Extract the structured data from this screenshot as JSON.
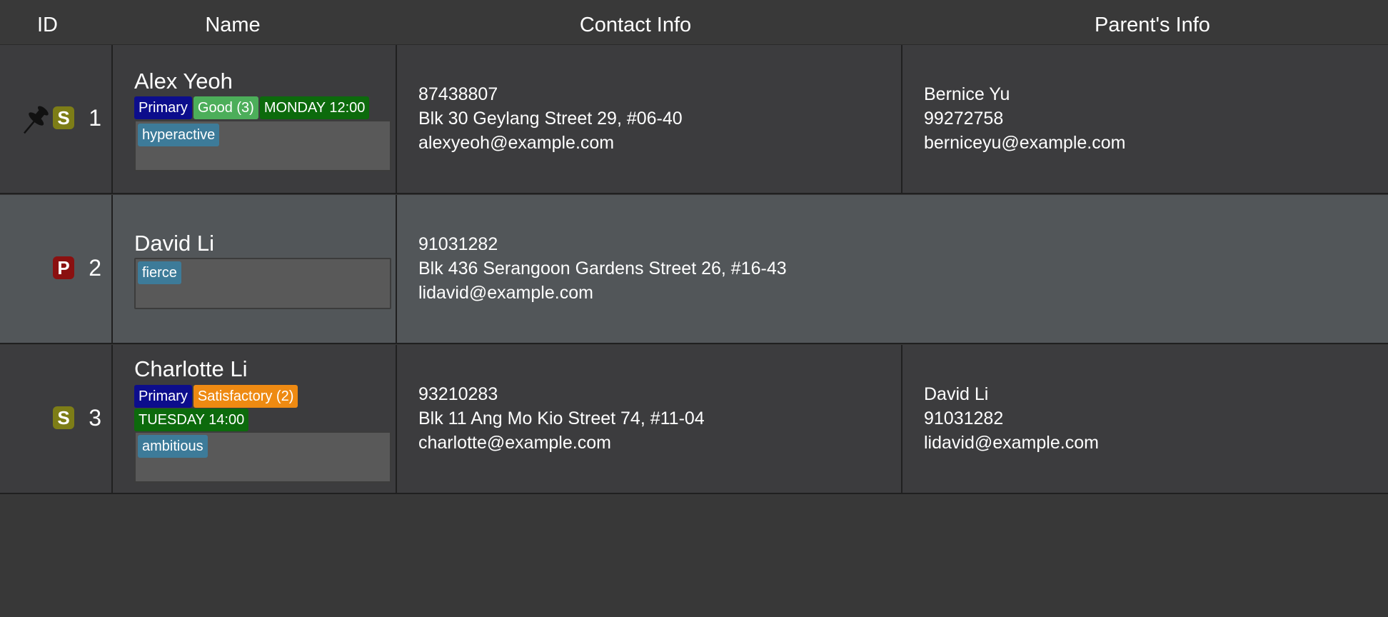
{
  "header": {
    "id": "ID",
    "name": "Name",
    "contact": "Contact Info",
    "parent": "Parent's Info"
  },
  "rows": [
    {
      "id": "1",
      "pinned": true,
      "badge": "S",
      "badge_color": "#7d7d17",
      "name": "Alex Yeoh",
      "level": "Primary",
      "grade": "Good (3)",
      "grade_color": "#4cae5a",
      "time": "MONDAY 12:00",
      "remark": "hyperactive",
      "phone": "87438807",
      "address": "Blk 30 Geylang Street 29, #06-40",
      "email": "alexyeoh@example.com",
      "parent_name": "Bernice Yu",
      "parent_phone": "99272758",
      "parent_email": "berniceyu@example.com"
    },
    {
      "id": "2",
      "pinned": false,
      "badge": "P",
      "badge_color": "#8a1010",
      "name": "David Li",
      "remark": "fierce",
      "phone": "91031282",
      "address": "Blk 436 Serangoon Gardens Street 26, #16-43",
      "email": "lidavid@example.com"
    },
    {
      "id": "3",
      "pinned": false,
      "badge": "S",
      "badge_color": "#7d7d17",
      "name": "Charlotte Li",
      "level": "Primary",
      "grade": "Satisfactory (2)",
      "grade_color": "#ee8a12",
      "time": "TUESDAY 14:00",
      "remark": "ambitious",
      "phone": "93210283",
      "address": "Blk 11 Ang Mo Kio Street 74, #11-04",
      "email": "charlotte@example.com",
      "parent_name": "David Li",
      "parent_phone": "91031282",
      "parent_email": "lidavid@example.com"
    }
  ]
}
